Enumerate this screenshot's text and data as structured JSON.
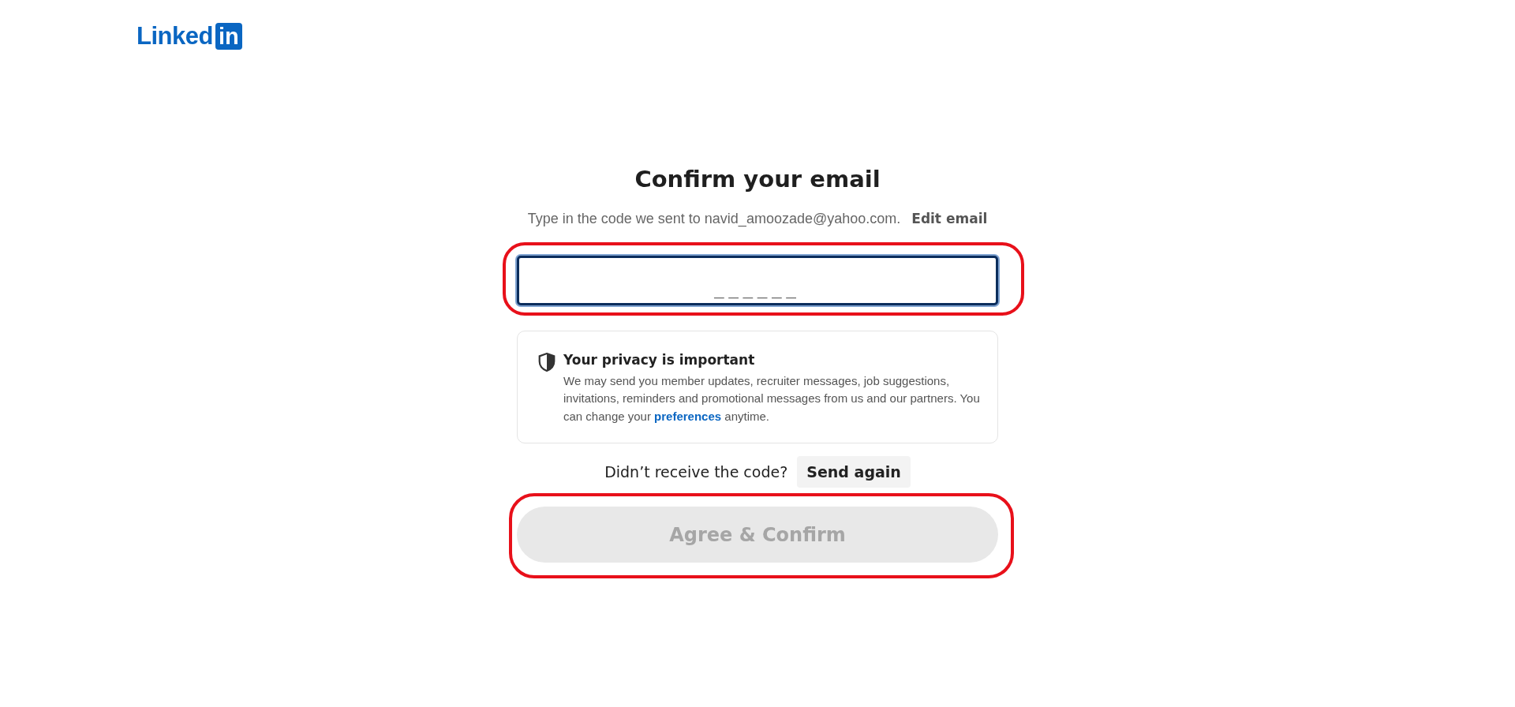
{
  "logo": {
    "word": "Linked",
    "badge": "in"
  },
  "heading": "Confirm your email",
  "instruction": {
    "text": "Type in the code we sent to navid_amoozade@yahoo.com.",
    "link": "Edit email"
  },
  "code_field": {
    "placeholder": "______",
    "focused": true,
    "highlighted": true
  },
  "privacy_notice": {
    "title": "Your privacy is important",
    "body_before": "We may send you member updates, recruiter messages, job suggestions, invitations, reminders and promotional messages from us and our partners. You can change your",
    "link": "preferences",
    "body_after": "anytime."
  },
  "resend": {
    "prompt": "Didn’t receive the code?",
    "button": "Send again"
  },
  "confirm_button": {
    "label": "Agree & Confirm",
    "disabled": true,
    "highlighted": true
  }
}
